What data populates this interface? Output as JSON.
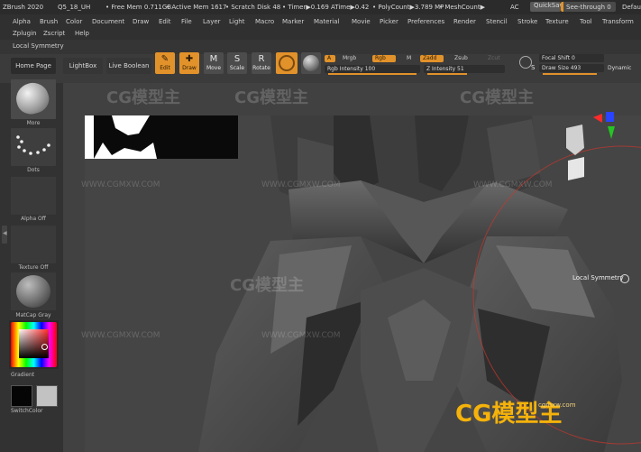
{
  "titlebar": {
    "app": "ZBrush 2020",
    "file": "Q5_18_UH",
    "free_mem": "• Free Mem 0.711GB",
    "active_mem": "• Active Mem 1617",
    "scratch": "• Scratch Disk 48",
    "timer": "• Timer▶0.169 ATime▶0.42",
    "poly": "• PolyCount▶3.789 MP",
    "mesh": "• MeshCount▶",
    "ac": "AC",
    "quicksave": "QuickSave",
    "see_through": "See-through  0",
    "default": "Default"
  },
  "menus": [
    "Alpha",
    "Brush",
    "Color",
    "Document",
    "Draw",
    "Edit",
    "File",
    "Layer",
    "Light",
    "Macro",
    "Marker",
    "Material",
    "Movie",
    "Picker",
    "Preferences",
    "Render",
    "Stencil",
    "Stroke",
    "Texture",
    "Tool",
    "Transform",
    "Zplugin",
    "Zscript",
    "Help"
  ],
  "subpalette": "Local Symmetry",
  "shelf": {
    "home_page": "Home Page",
    "lightbox": "LightBox",
    "live_boolean": "Live Boolean",
    "tools": [
      {
        "label": "Edit",
        "glyph": "✎",
        "active": true
      },
      {
        "label": "Draw",
        "glyph": "✚",
        "active": true
      },
      {
        "label": "Move",
        "glyph": "M",
        "active": false
      },
      {
        "label": "Scale",
        "glyph": "S",
        "active": false
      },
      {
        "label": "Rotate",
        "glyph": "R",
        "active": false
      }
    ],
    "a_btn": "A",
    "mrgb": "Mrgb",
    "rgb": "Rgb",
    "m": "M",
    "zadd": "Zadd",
    "zsub": "Zsub",
    "zcut": "Zcut",
    "rgb_intensity": "Rgb Intensity 100",
    "z_intensity": "Z Intensity 51",
    "focal_shift": "Focal Shift 0",
    "draw_size": "Draw Size 493",
    "dynamic": "Dynamic",
    "s_label": "S"
  },
  "left_tray": {
    "more": "More",
    "dots": "Dots",
    "alpha_off": "Alpha Off",
    "texture_off": "Texture Off",
    "matcap_gray": "MatCap Gray",
    "gradient": "Gradient",
    "switch_color": "SwitchColor"
  },
  "viewport": {
    "local_symmetry_tip": "Local Symmetry"
  },
  "watermarks": {
    "logo": "CG模型主",
    "url": "WWW.CGMXW.COM",
    "corner_url": "cgmxw.com"
  },
  "colors": {
    "accent_orange": "#e2922a",
    "bg_dark": "#2b2b2b"
  }
}
